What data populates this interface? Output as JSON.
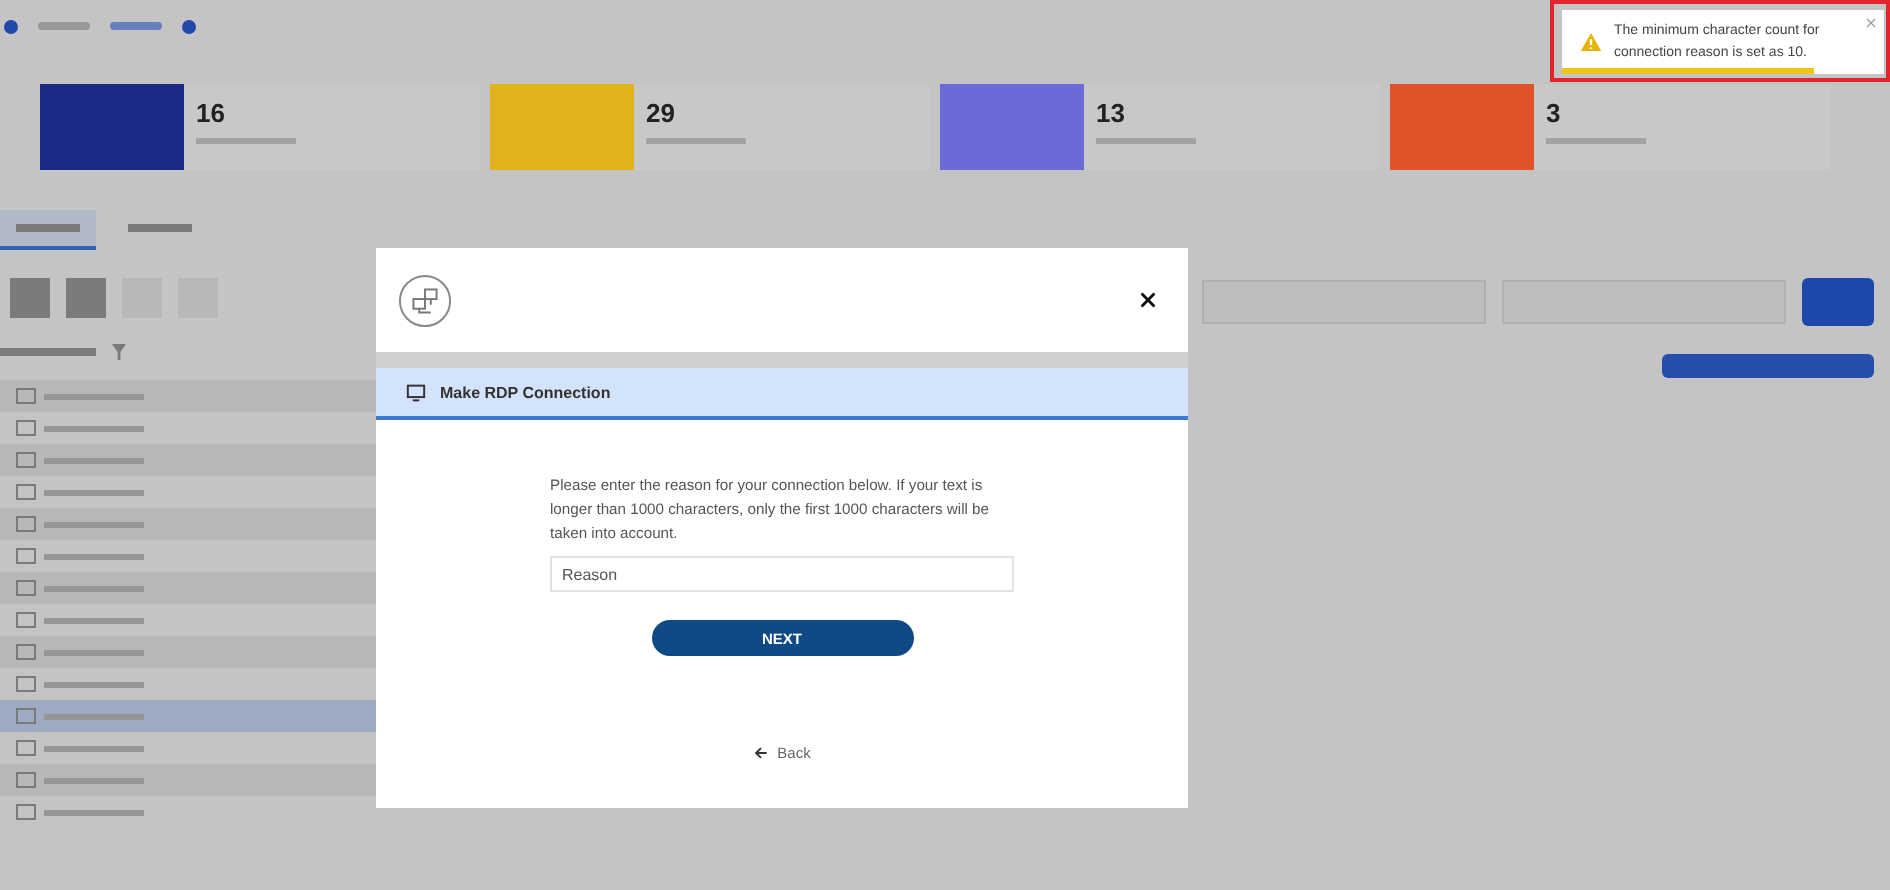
{
  "stats": [
    {
      "value": "16",
      "color": "#1c2a86"
    },
    {
      "value": "29",
      "color": "#e2b21c"
    },
    {
      "value": "13",
      "color": "#6a6ad8"
    },
    {
      "value": "3",
      "color": "#e0522a"
    }
  ],
  "tabs": [
    {
      "selected": true
    },
    {
      "selected": false
    }
  ],
  "tree_rows": [
    {
      "selected": false
    },
    {
      "selected": false
    },
    {
      "selected": false
    },
    {
      "selected": false
    },
    {
      "selected": false
    },
    {
      "selected": false
    },
    {
      "selected": false
    },
    {
      "selected": false
    },
    {
      "selected": false
    },
    {
      "selected": false
    },
    {
      "selected": true
    },
    {
      "selected": false
    },
    {
      "selected": false
    },
    {
      "selected": false
    }
  ],
  "modal": {
    "title": "Make RDP Connection",
    "message": "Please enter the reason for your connection below. If your text is longer than 1000 characters, only the first 1000 characters will be taken into account.",
    "reason_field": {
      "placeholder": "Reason"
    },
    "next_button": "NEXT",
    "back_link": "Back"
  },
  "toast": {
    "message": "The minimum character count for connection reason is set as 10.",
    "level": 0.78
  }
}
